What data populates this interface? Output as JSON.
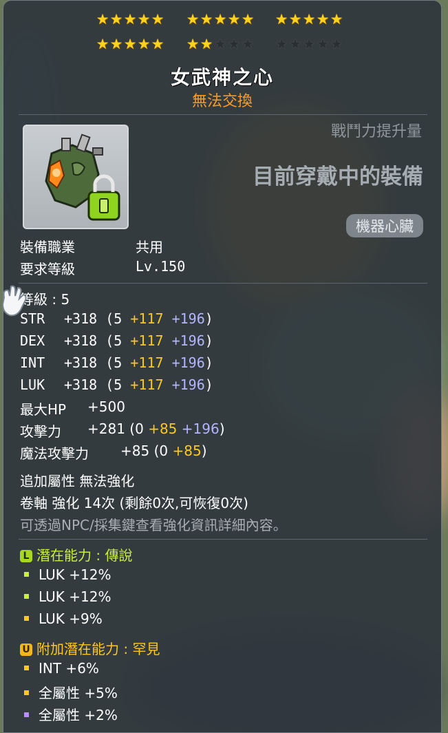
{
  "stars": {
    "rows": [
      {
        "groups": [
          5,
          5,
          5
        ],
        "filled": [
          5,
          5,
          5
        ]
      },
      {
        "groups": [
          5,
          5,
          5
        ],
        "filled": [
          5,
          2,
          0
        ]
      }
    ]
  },
  "item": {
    "name": "女武神之心",
    "trade_status": "無法交換",
    "cp_label": "戰鬥力提升量",
    "wearing_label": "目前穿戴中的裝備",
    "category": "機器心臟",
    "job_label": "裝備職業",
    "job_value": "共用",
    "req_level_label": "要求等級",
    "req_level_value": "Lv.150"
  },
  "stats": {
    "level_line": "等級 : 5",
    "rows": [
      {
        "name": "STR",
        "total": "+318",
        "base": "(5",
        "bonus_y": "+117",
        "bonus_b": "+196",
        "close": ")"
      },
      {
        "name": "DEX",
        "total": "+318",
        "base": "(5",
        "bonus_y": "+117",
        "bonus_b": "+196",
        "close": ")"
      },
      {
        "name": "INT",
        "total": "+318",
        "base": "(5",
        "bonus_y": "+117",
        "bonus_b": "+196",
        "close": ")"
      },
      {
        "name": "LUK",
        "total": "+318",
        "base": "(5",
        "bonus_y": "+117",
        "bonus_b": "+196",
        "close": ")"
      }
    ],
    "maxhp": {
      "name": "最大HP",
      "total": "+500"
    },
    "att": {
      "name": "攻擊力",
      "total": "+281",
      "base": "(0",
      "bonus_y": "+85",
      "bonus_b": "+196",
      "close": ")"
    },
    "matt": {
      "name": "魔法攻擊力",
      "total": "+85",
      "base": "(0",
      "bonus_y": "+85",
      "close": ")"
    }
  },
  "enhance": {
    "bonus_line": "追加屬性 無法強化",
    "scroll_line": "卷軸 強化 14次 (剩餘0次,可恢復0次)",
    "hint_line": "可透過NPC/採集鍵查看強化資訊詳細內容。"
  },
  "potential": {
    "badge": "L",
    "header": "潛在能力 : 傳說",
    "color": "#c8f03c",
    "lines": [
      "LUK +12%",
      "LUK +12%",
      "LUK +9%"
    ],
    "bullet_colors": [
      "#c8f03c",
      "#c8f03c",
      "#ffc81e"
    ]
  },
  "additional": {
    "badge": "U",
    "header": "附加潛在能力 : 罕見",
    "color": "#ffc81e",
    "lines": [
      "INT +6%",
      "全屬性 +5%",
      "全屬性 +2%"
    ],
    "bullet_colors": [
      "#ffc81e",
      "#ffc81e",
      "#b98cff"
    ]
  }
}
